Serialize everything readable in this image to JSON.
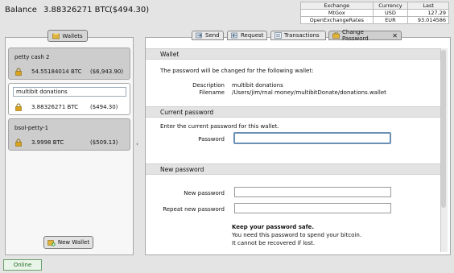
{
  "balance": {
    "label": "Balance",
    "btc": "3.88326271 BTC",
    "fiat": "($494.30)"
  },
  "rates": {
    "headers": [
      "Exchange",
      "Currency",
      "Last"
    ],
    "rows": [
      [
        "MtGox",
        "USD",
        "127.29"
      ],
      [
        "OpenExchangeRates",
        "EUR",
        "93.014586"
      ]
    ]
  },
  "wallets": {
    "tab_label": "Wallets",
    "items": [
      {
        "name": "petty cash 2",
        "btc": "54.55184014 BTC",
        "fiat": "($6,943.90)"
      },
      {
        "name": "multibit donations",
        "btc": "3.88326271 BTC",
        "fiat": "($494.30)"
      },
      {
        "name": "bsol-petty-1",
        "btc": "3.9998 BTC",
        "fiat": "($509.13)"
      }
    ],
    "new_wallet_label": "New Wallet"
  },
  "collapse_arrow": "‹",
  "tabs": {
    "send": "Send",
    "request": "Request",
    "transactions": "Transactions",
    "change_password": "Change Password",
    "close": "✕"
  },
  "form": {
    "wallet_section": "Wallet",
    "wallet_intro": "The password will be changed for the following wallet:",
    "description_label": "Description",
    "description_value": "multibit donations",
    "filename_label": "Filename",
    "filename_value": "/Users/jim/rnal money/multibitDonate/donations.wallet",
    "current_section": "Current password",
    "current_intro": "Enter the current password for this wallet.",
    "password_label": "Password",
    "new_section": "New password",
    "new_password_label": "New password",
    "repeat_label": "Repeat new password",
    "safe_heading": "Keep your password safe.",
    "safe_line1": "You need this password to spend your bitcoin.",
    "safe_line2": "It cannot be recovered if lost."
  },
  "status": "Online",
  "colors": {
    "status_green": "#1f6a1f",
    "focus_blue": "#6b8fb5",
    "lock_gold": "#d9a21c"
  }
}
